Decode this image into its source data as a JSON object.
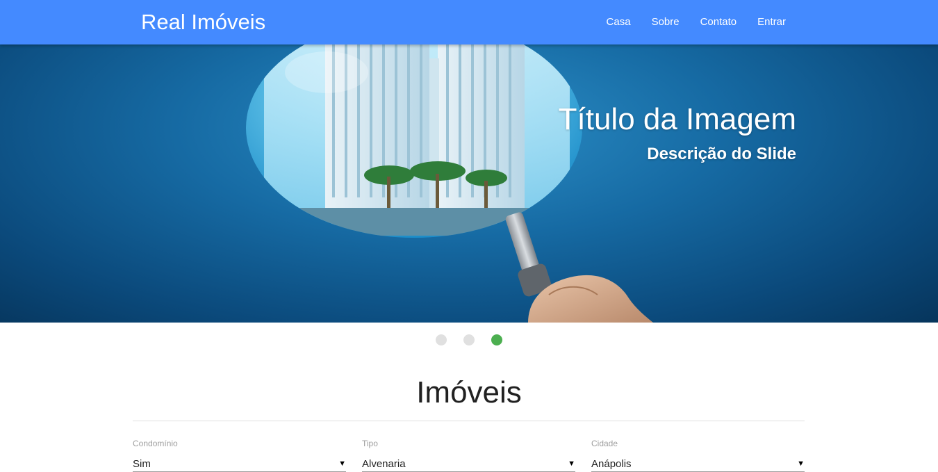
{
  "navbar": {
    "brand": "Real Imóveis",
    "links": [
      "Casa",
      "Sobre",
      "Contato",
      "Entrar"
    ],
    "color": "#448aff"
  },
  "slider": {
    "caption_title": "Título da Imagem",
    "caption_description": "Descrição do Slide",
    "active_indicator": 3,
    "indicator_count": 3,
    "active_color": "#4caf50"
  },
  "section": {
    "title": "Imóveis"
  },
  "filters": [
    {
      "label": "Condomínio",
      "value": "Sim"
    },
    {
      "label": "Tipo",
      "value": "Alvenaria"
    },
    {
      "label": "Cidade",
      "value": "Anápolis"
    }
  ],
  "icons": {
    "caret": "▼"
  }
}
